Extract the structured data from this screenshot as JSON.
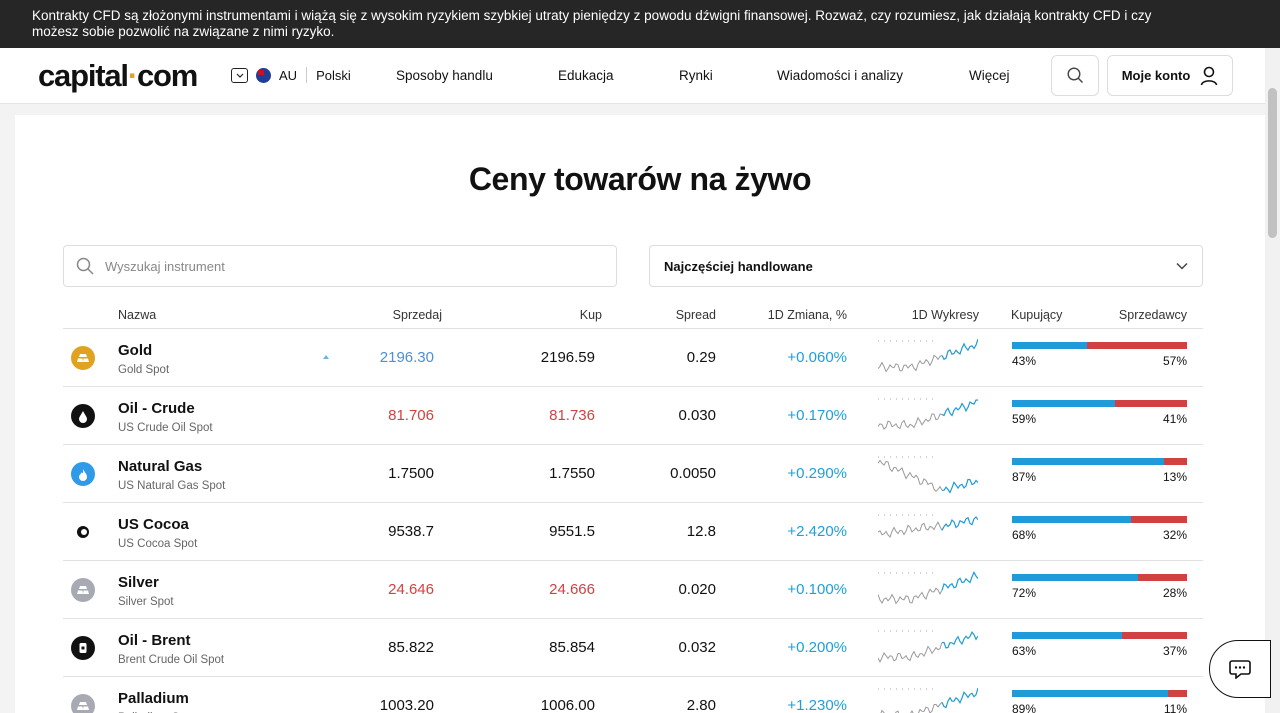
{
  "risk_warning": "Kontrakty CFD są złożonymi instrumentami i wiążą się z wysokim ryzykiem szybkiej utraty pieniędzy z powodu dźwigni finansowej. Rozważ, czy rozumiesz, jak działają kontrakty CFD i czy możesz sobie pozwolić na związane z nimi ryzyko.",
  "header": {
    "logo_left": "capital",
    "logo_dot": "·",
    "logo_right": "com",
    "country": "AU",
    "language": "Polski",
    "nav": [
      "Sposoby handlu",
      "Edukacja",
      "Rynki",
      "Wiadomości i analizy",
      "Więcej"
    ],
    "account_label": "Moje konto"
  },
  "main": {
    "title": "Ceny towarów na żywo",
    "search_placeholder": "Wyszukaj instrument",
    "filter_selected": "Najczęściej handlowane",
    "columns": {
      "name": "Nazwa",
      "sell": "Sprzedaj",
      "buy": "Kup",
      "spread": "Spread",
      "change": "1D Zmiana, %",
      "chart": "1D Wykresy",
      "buyers": "Kupujący",
      "sellers": "Sprzedawcy"
    },
    "rows": [
      {
        "name": "Gold",
        "sub": "Gold Spot",
        "sell": "2196.30",
        "buy": "2196.59",
        "spread": "0.29",
        "change": "+0.060%",
        "buyers": "43%",
        "sellers": "57%",
        "buyers_share": 0.43,
        "sell_color": "blue",
        "buy_color": "black",
        "icon": "gold-bars-icon",
        "icon_color": "#e0a321"
      },
      {
        "name": "Oil - Crude",
        "sub": "US Crude Oil Spot",
        "sell": "81.706",
        "buy": "81.736",
        "spread": "0.030",
        "change": "+0.170%",
        "buyers": "59%",
        "sellers": "41%",
        "buyers_share": 0.59,
        "sell_color": "red",
        "buy_color": "red",
        "icon": "oil-drop-icon",
        "icon_color": "#111111"
      },
      {
        "name": "Natural Gas",
        "sub": "US Natural Gas Spot",
        "sell": "1.7500",
        "buy": "1.7550",
        "spread": "0.0050",
        "change": "+0.290%",
        "buyers": "87%",
        "sellers": "13%",
        "buyers_share": 0.87,
        "sell_color": "black",
        "buy_color": "black",
        "icon": "flame-icon",
        "icon_color": "#2f9be8"
      },
      {
        "name": "US Cocoa",
        "sub": "US Cocoa Spot",
        "sell": "9538.7",
        "buy": "9551.5",
        "spread": "12.8",
        "change": "+2.420%",
        "buyers": "68%",
        "sellers": "32%",
        "buyers_share": 0.68,
        "sell_color": "black",
        "buy_color": "black",
        "icon": "cocoa-icon",
        "icon_color": "#ffffff"
      },
      {
        "name": "Silver",
        "sub": "Silver Spot",
        "sell": "24.646",
        "buy": "24.666",
        "spread": "0.020",
        "change": "+0.100%",
        "buyers": "72%",
        "sellers": "28%",
        "buyers_share": 0.72,
        "sell_color": "red",
        "buy_color": "red",
        "icon": "silver-bars-icon",
        "icon_color": "#a7a9b3"
      },
      {
        "name": "Oil - Brent",
        "sub": "Brent Crude Oil Spot",
        "sell": "85.822",
        "buy": "85.854",
        "spread": "0.032",
        "change": "+0.200%",
        "buyers": "63%",
        "sellers": "37%",
        "buyers_share": 0.63,
        "sell_color": "black",
        "buy_color": "black",
        "icon": "oil-barrel-icon",
        "icon_color": "#111111"
      },
      {
        "name": "Palladium",
        "sub": "Palladium Spot",
        "sell": "1003.20",
        "buy": "1006.00",
        "spread": "2.80",
        "change": "+1.230%",
        "buyers": "89%",
        "sellers": "11%",
        "buyers_share": 0.89,
        "sell_color": "black",
        "buy_color": "black",
        "icon": "palladium-bars-icon",
        "icon_color": "#a7a9b3"
      }
    ]
  },
  "colors": {
    "accent_blue": "#1e9bd8",
    "accent_red": "#d24141",
    "logo_dot": "#e0a033"
  }
}
